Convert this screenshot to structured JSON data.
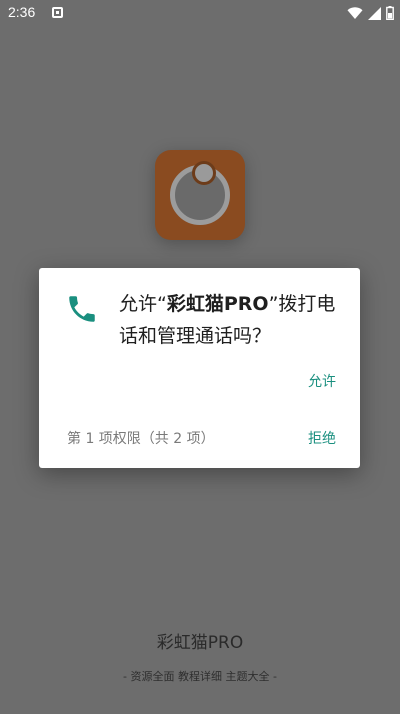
{
  "status_bar": {
    "time": "2:36",
    "icons": [
      "notification-icon",
      "wifi-icon",
      "signal-icon",
      "battery-icon"
    ]
  },
  "dialog": {
    "message_prefix": "允许“",
    "app_name": "彩虹猫PRO",
    "message_suffix": "”拨打电话和管理通话吗？",
    "allow_label": "允许",
    "counter": "第 1 项权限（共 2 项）",
    "deny_label": "拒绝",
    "icon": "phone-icon"
  },
  "footer": {
    "app_name": "彩虹猫PRO",
    "tagline": "- 资源全面 教程详细 主题大全 -"
  },
  "colors": {
    "accent": "#1a8f7f",
    "overlay": "#6d6d6d",
    "app_icon_bg": "#8a4b20"
  }
}
